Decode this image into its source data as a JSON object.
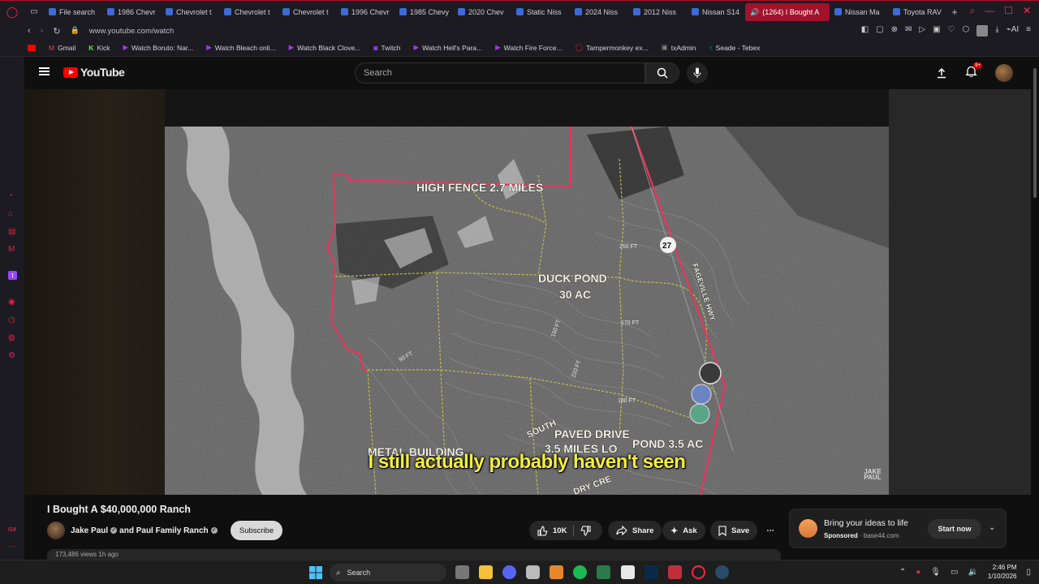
{
  "browser": {
    "tabs": [
      {
        "label": "File search"
      },
      {
        "label": "1986 Chevr"
      },
      {
        "label": "Chevrolet t"
      },
      {
        "label": "Chevrolet t"
      },
      {
        "label": "Chevrolet t"
      },
      {
        "label": "1996 Chevr"
      },
      {
        "label": "1985 Chevy"
      },
      {
        "label": "2020 Chev"
      },
      {
        "label": "Static Niss"
      },
      {
        "label": "2024 Niss"
      },
      {
        "label": "2012 Niss"
      },
      {
        "label": "Nissan S14"
      },
      {
        "label": "(1264) I Bought A"
      },
      {
        "label": "Nissan Ma"
      },
      {
        "label": "Toyota RAV"
      }
    ],
    "url": "www.youtube.com/watch",
    "ai_label": "AI",
    "bookmarks": [
      {
        "label": "Gmail",
        "color": "#ea4335"
      },
      {
        "label": "Kick",
        "color": "#53fc18"
      },
      {
        "label": "Watch Boruto: Nar...",
        "color": "#a040e0"
      },
      {
        "label": "Watch Bleach onli...",
        "color": "#a040e0"
      },
      {
        "label": "Watch Black Clove...",
        "color": "#a040e0"
      },
      {
        "label": "Twitch",
        "color": "#9146ff"
      },
      {
        "label": "Watch Hell's Para...",
        "color": "#a040e0"
      },
      {
        "label": "Watch Fire Force...",
        "color": "#a040e0"
      },
      {
        "label": "Tampermonkey ex...",
        "color": "#e02244"
      },
      {
        "label": "txAdmin",
        "color": "#888888"
      },
      {
        "label": "Seade - Tebex",
        "color": "#2fb5a0"
      }
    ]
  },
  "youtube": {
    "logo_text": "YouTube",
    "search_placeholder": "Search",
    "notifications_badge": "9+",
    "video_title": "I Bought A $40,000,000 Ranch",
    "channel": {
      "name": "Jake Paul",
      "joiner": "and",
      "collab": "Paul Family Ranch"
    },
    "subscribe_label": "Subscribe",
    "actions": {
      "likes": "10K",
      "share": "Share",
      "ask": "Ask",
      "save": "Save"
    },
    "description_preview": "173,486 views  1h ago",
    "caption": "I still actually probably haven't seen",
    "watermark": "JAKE PAUL",
    "map_labels": {
      "high_fence": "HIGH FENCE 2.7 MILES",
      "duck_pond_1": "DUCK POND",
      "duck_pond_2": "30 AC",
      "paved_1": "PAVED DRIVE",
      "paved_2": "3.5 MILES LO",
      "pond": "POND 3.5 AC",
      "metal": "METAL BUILDING",
      "south": "SOUTH",
      "dry": "DRY CRE",
      "elev_250": "250 FT",
      "elev_170": "170 FT",
      "elev_150": "150 FT",
      "elev_90": "90 FT",
      "elev_180": "180 FT",
      "elev_220": "220 FT",
      "road": "FAGEVILLE HWY",
      "route": "27"
    },
    "ad": {
      "title": "Bring your ideas to life",
      "sponsored": "Sponsored",
      "domain": "base44.com",
      "cta": "Start now"
    }
  },
  "taskbar": {
    "search_label": "Search",
    "time": "2:46 PM",
    "date": "1/10/2026"
  },
  "colors": {
    "accent": "#e02244",
    "youtube_red": "#ff0000",
    "caption_yellow": "#f3ef3a",
    "map_boundary": "#e8355a",
    "map_trails": "#c8c84a"
  }
}
